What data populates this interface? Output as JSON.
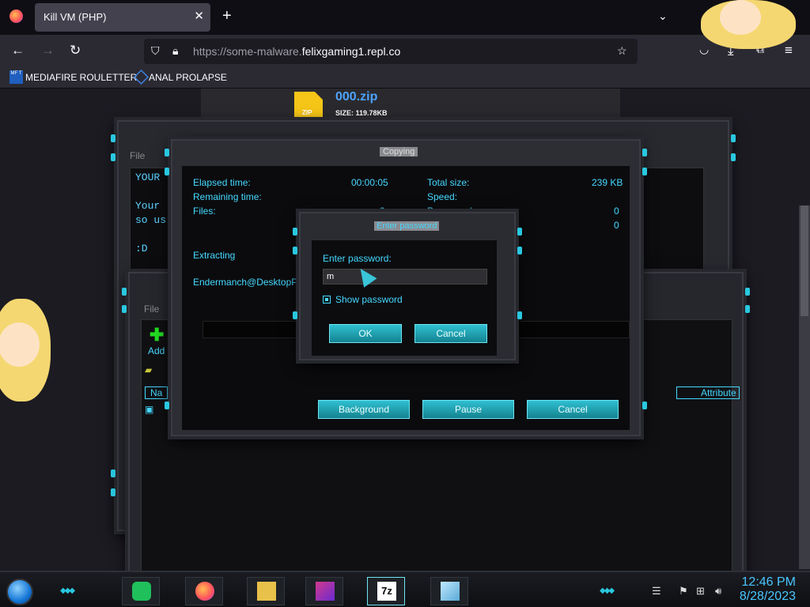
{
  "browser": {
    "tab_title": "Kill VM (PHP)",
    "tab_close": "✕",
    "new_tab": "+",
    "tabs_menu": "⌄",
    "url_plain": "https://some-malware.",
    "url_domain": "felixgaming1.repl.co",
    "bookmarks": [
      {
        "label": "MEDIAFIRE ROULETTER",
        "icon_text": "MF T"
      },
      {
        "label": "ANAL PROLAPSE"
      }
    ]
  },
  "download": {
    "file_name": "000.zip",
    "file_size": "SIZE: 119.78KB",
    "icon_text": "ZIP"
  },
  "notepad": {
    "menu": "File",
    "lines": [
      "YOUR",
      "Your",
      "so us",
      ":D"
    ]
  },
  "sevenzip": {
    "menu": "File",
    "add_label": "Add",
    "col_name": "Na",
    "col_attr": "Attribute"
  },
  "copy_dialog": {
    "title": "Copying",
    "elapsed_label": "Elapsed time:",
    "elapsed_value": "00:00:05",
    "remaining_label": "Remaining time:",
    "files_label": "Files:",
    "files_value": "0",
    "total_label": "Total size:",
    "total_value": "239 KB",
    "speed_label": "Speed:",
    "processed_label": "Processed:",
    "processed_value": "0",
    "compressed_value": "0",
    "extracting_label": "Extracting",
    "path": "Endermanch@DesktopPuzz",
    "background_btn": "Background",
    "pause_btn": "Pause",
    "cancel_btn": "Cancel"
  },
  "password_dialog": {
    "title": "Enter password",
    "prompt": "Enter password:",
    "value": "m",
    "show_password": "Show password",
    "ok": "OK",
    "cancel": "Cancel"
  },
  "taskbar": {
    "time": "12:46 PM",
    "date": "8/28/2023",
    "sevenzip_label": "7z"
  },
  "colors": {
    "accent": "#29c8e0",
    "link": "#4da3ff",
    "clock": "#4ac6ff"
  }
}
